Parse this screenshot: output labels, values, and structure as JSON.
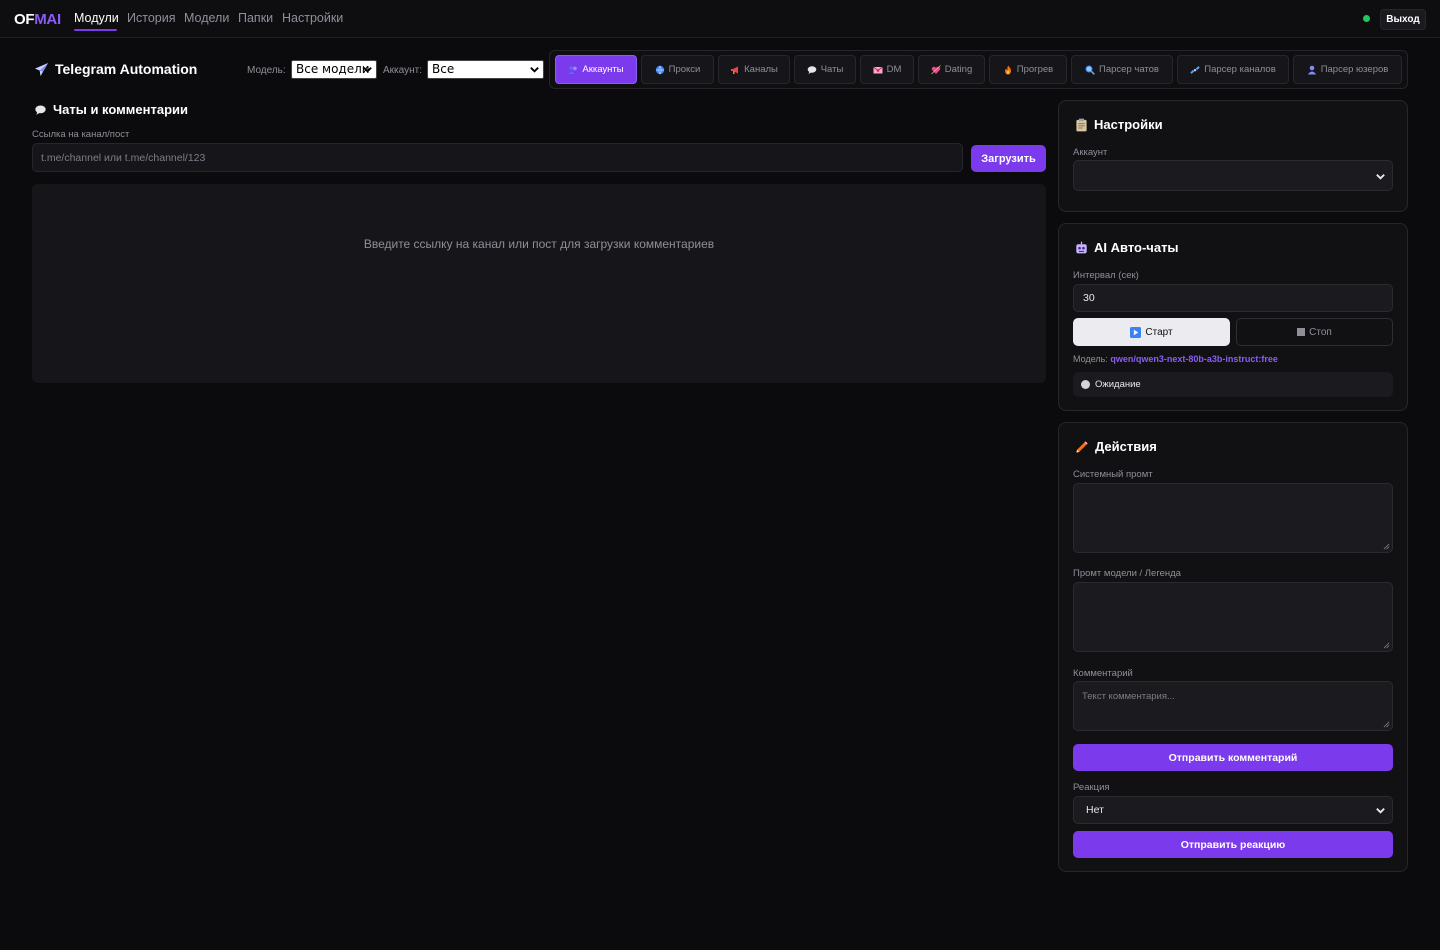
{
  "nav": {
    "logo_a": "OF",
    "logo_b": "MAI",
    "items": [
      "Модули",
      "История",
      "Модели",
      "Папки",
      "Настройки"
    ],
    "logout": "Выход",
    "colors": {
      "accent": "#7c3aed",
      "online": "#22c55e"
    }
  },
  "header": {
    "title": "Telegram Automation",
    "model_label": "Модель:",
    "model_value": "Все модели",
    "account_label": "Аккаунт:",
    "account_value": "Все",
    "tabs": [
      {
        "label": "Аккаунты",
        "icon": "users-icon",
        "active": true
      },
      {
        "label": "Прокси",
        "icon": "globe-icon"
      },
      {
        "label": "Каналы",
        "icon": "megaphone-icon"
      },
      {
        "label": "Чаты",
        "icon": "speech-bubble-icon"
      },
      {
        "label": "DM",
        "icon": "envelope-icon"
      },
      {
        "label": "Dating",
        "icon": "heart-arrow-icon"
      },
      {
        "label": "Прогрев",
        "icon": "fire-icon"
      },
      {
        "label": "Парсер чатов",
        "icon": "magnifier-icon"
      },
      {
        "label": "Парсер каналов",
        "icon": "satellite-icon"
      },
      {
        "label": "Парсер юзеров",
        "icon": "user-icon"
      }
    ]
  },
  "chats": {
    "title": "Чаты и комментарии",
    "link_label": "Ссылка на канал/пост",
    "link_placeholder": "t.me/channel или t.me/channel/123",
    "load_button": "Загрузить",
    "empty_text": "Введите ссылку на канал или пост для загрузки комментариев"
  },
  "settings": {
    "title": "Настройки",
    "account_label": "Аккаунт",
    "account_value": ""
  },
  "autochats": {
    "title": "AI Авто-чаты",
    "interval_label": "Интервал (сек)",
    "interval_value": "30",
    "start_button": "Старт",
    "stop_button": "Стоп",
    "model_prefix": "Модель:",
    "model_name": "qwen/qwen3-next-80b-a3b-instruct:free",
    "status": "Ожидание"
  },
  "actions": {
    "title": "Действия",
    "system_prompt_label": "Системный промт",
    "model_prompt_label": "Промт модели / Легенда",
    "comment_label": "Комментарий",
    "comment_placeholder": "Текст комментария...",
    "send_comment_button": "Отправить комментарий",
    "reaction_label": "Реакция",
    "reaction_value": "Нет",
    "send_reaction_button": "Отправить реакцию"
  }
}
